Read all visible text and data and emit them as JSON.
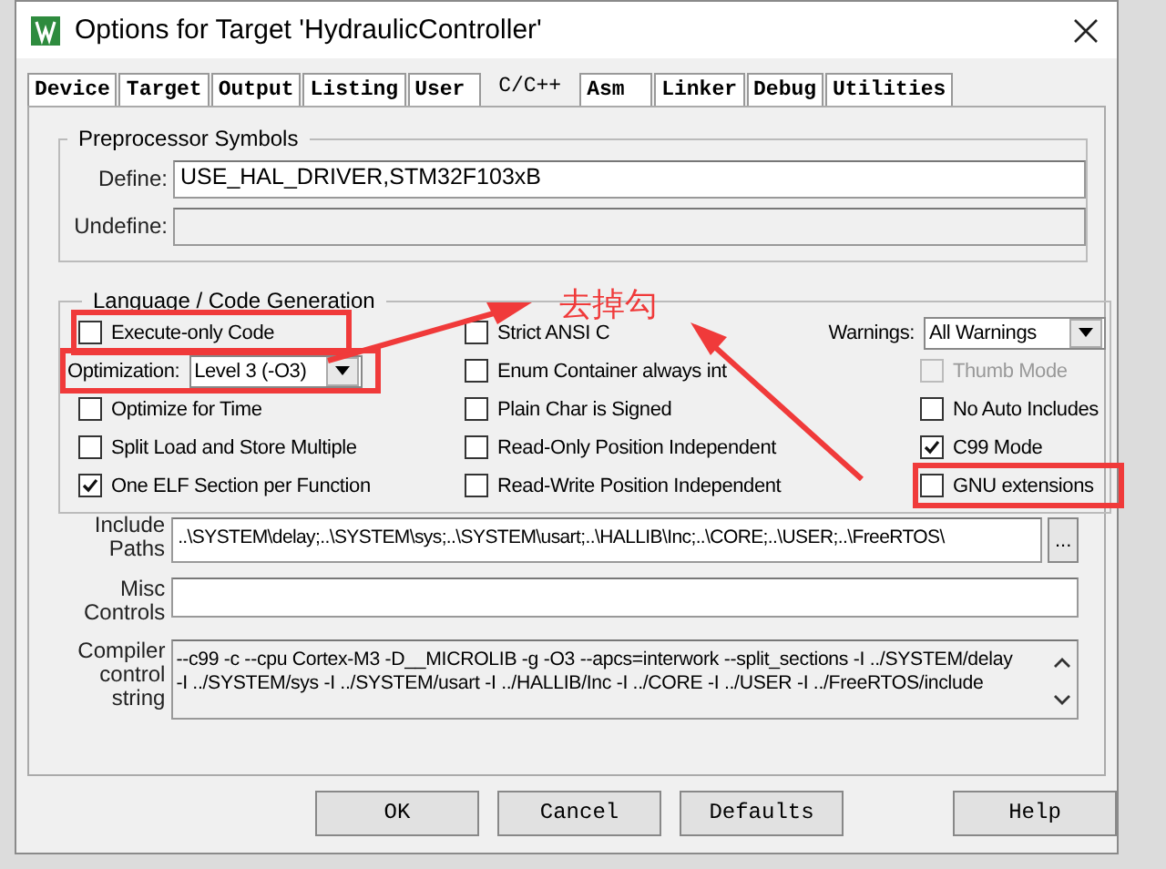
{
  "window": {
    "title": "Options for Target 'HydraulicController'"
  },
  "tabs": [
    {
      "label": "Device",
      "selected": false
    },
    {
      "label": "Target",
      "selected": false
    },
    {
      "label": "Output",
      "selected": false
    },
    {
      "label": "Listing",
      "selected": false
    },
    {
      "label": "User",
      "selected": false
    },
    {
      "label": "C/C++",
      "selected": true
    },
    {
      "label": "Asm",
      "selected": false
    },
    {
      "label": "Linker",
      "selected": false
    },
    {
      "label": "Debug",
      "selected": false
    },
    {
      "label": "Utilities",
      "selected": false
    }
  ],
  "preprocessor": {
    "title": "Preprocessor Symbols",
    "define_label": "Define:",
    "define_value": "USE_HAL_DRIVER,STM32F103xB",
    "undefine_label": "Undefine:"
  },
  "language": {
    "title": "Language / Code Generation",
    "columns": [
      [
        {
          "kind": "checkbox",
          "label": "Execute-only Code",
          "checked": false,
          "disabled": false,
          "highlighted": true
        },
        {
          "kind": "select",
          "label": "Optimization:",
          "value": "Level 3 (-O3)",
          "highlighted": true
        },
        {
          "kind": "checkbox",
          "label": "Optimize for Time",
          "checked": false,
          "disabled": false,
          "highlighted": false
        },
        {
          "kind": "checkbox",
          "label": "Split Load and Store Multiple",
          "checked": false,
          "disabled": false,
          "highlighted": false
        },
        {
          "kind": "checkbox",
          "label": "One ELF Section per Function",
          "checked": true,
          "disabled": false,
          "highlighted": false
        }
      ],
      [
        {
          "kind": "checkbox",
          "label": "Strict ANSI C",
          "checked": false,
          "disabled": false,
          "highlighted": false
        },
        {
          "kind": "checkbox",
          "label": "Enum Container always int",
          "checked": false,
          "disabled": false,
          "highlighted": false
        },
        {
          "kind": "checkbox",
          "label": "Plain Char is Signed",
          "checked": false,
          "disabled": false,
          "highlighted": false
        },
        {
          "kind": "checkbox",
          "label": "Read-Only Position Independent",
          "checked": false,
          "disabled": false,
          "highlighted": false
        },
        {
          "kind": "checkbox",
          "label": "Read-Write Position Independent",
          "checked": false,
          "disabled": false,
          "highlighted": false
        }
      ],
      [
        {
          "kind": "select",
          "label": "Warnings:",
          "value": "All Warnings",
          "highlighted": false
        },
        {
          "kind": "checkbox",
          "label": "Thumb Mode",
          "checked": false,
          "disabled": true,
          "highlighted": false
        },
        {
          "kind": "checkbox",
          "label": "No Auto Includes",
          "checked": false,
          "disabled": false,
          "highlighted": false
        },
        {
          "kind": "checkbox",
          "label": "C99 Mode",
          "checked": true,
          "disabled": false,
          "highlighted": false
        },
        {
          "kind": "checkbox",
          "label": "GNU extensions",
          "checked": false,
          "disabled": false,
          "highlighted": true
        }
      ]
    ]
  },
  "annotation": {
    "text": "去掉勾"
  },
  "include_paths": {
    "label_lines": [
      "Include",
      "Paths"
    ],
    "value": "..\\SYSTEM\\delay;..\\SYSTEM\\sys;..\\SYSTEM\\usart;..\\HALLIB\\Inc;..\\CORE;..\\USER;..\\FreeRTOS\\",
    "browse": "..."
  },
  "misc_controls": {
    "label_lines": [
      "Misc",
      "Controls"
    ]
  },
  "compiler_string": {
    "label_lines": [
      "Compiler",
      "control",
      "string"
    ],
    "lines": [
      "--c99 -c --cpu Cortex-M3 -D__MICROLIB -g -O3 --apcs=interwork --split_sections -I ../SYSTEM/delay",
      "-I ../SYSTEM/sys -I ../SYSTEM/usart -I ../HALLIB/Inc -I ../CORE -I ../USER -I ../FreeRTOS/include"
    ]
  },
  "buttons": [
    "OK",
    "Cancel",
    "Defaults",
    "Help"
  ]
}
